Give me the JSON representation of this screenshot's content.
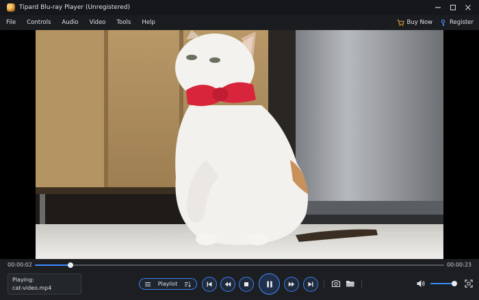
{
  "window": {
    "title": "Tipard Blu-ray Player (Unregistered)"
  },
  "menu": {
    "items": [
      {
        "label": "File",
        "name": "menu-file"
      },
      {
        "label": "Controls",
        "name": "menu-controls"
      },
      {
        "label": "Audio",
        "name": "menu-audio"
      },
      {
        "label": "Video",
        "name": "menu-video"
      },
      {
        "label": "Tools",
        "name": "menu-tools"
      },
      {
        "label": "Help",
        "name": "menu-help"
      }
    ],
    "buy_now": "Buy Now",
    "register": "Register"
  },
  "player": {
    "time_current": "00:00:02",
    "time_total": "00:00:23",
    "progress_fraction": 0.087,
    "volume_fraction": 0.92,
    "now_playing_label": "Playing:",
    "now_playing_file": "cat-video.mp4",
    "playlist_label": "Playlist",
    "state": "playing"
  },
  "icons": {
    "logo": "tipard-logo-icon",
    "minimize": "minimize-icon",
    "maximize": "maximize-icon",
    "close": "close-icon",
    "cart": "cart-icon",
    "register": "key-icon",
    "playlist": "list-icon",
    "sort": "sort-icon",
    "prev": "skip-previous-icon",
    "rewind": "rewind-icon",
    "stop": "stop-icon",
    "pause": "pause-icon",
    "forward": "fast-forward-icon",
    "next": "skip-next-icon",
    "snapshot": "camera-icon",
    "open_folder": "folder-icon",
    "volume": "volume-icon",
    "fullscreen": "fullscreen-icon"
  },
  "colors": {
    "accent": "#3b8cff",
    "button_border": "#3b7ff0",
    "background": "#1c1e22"
  }
}
